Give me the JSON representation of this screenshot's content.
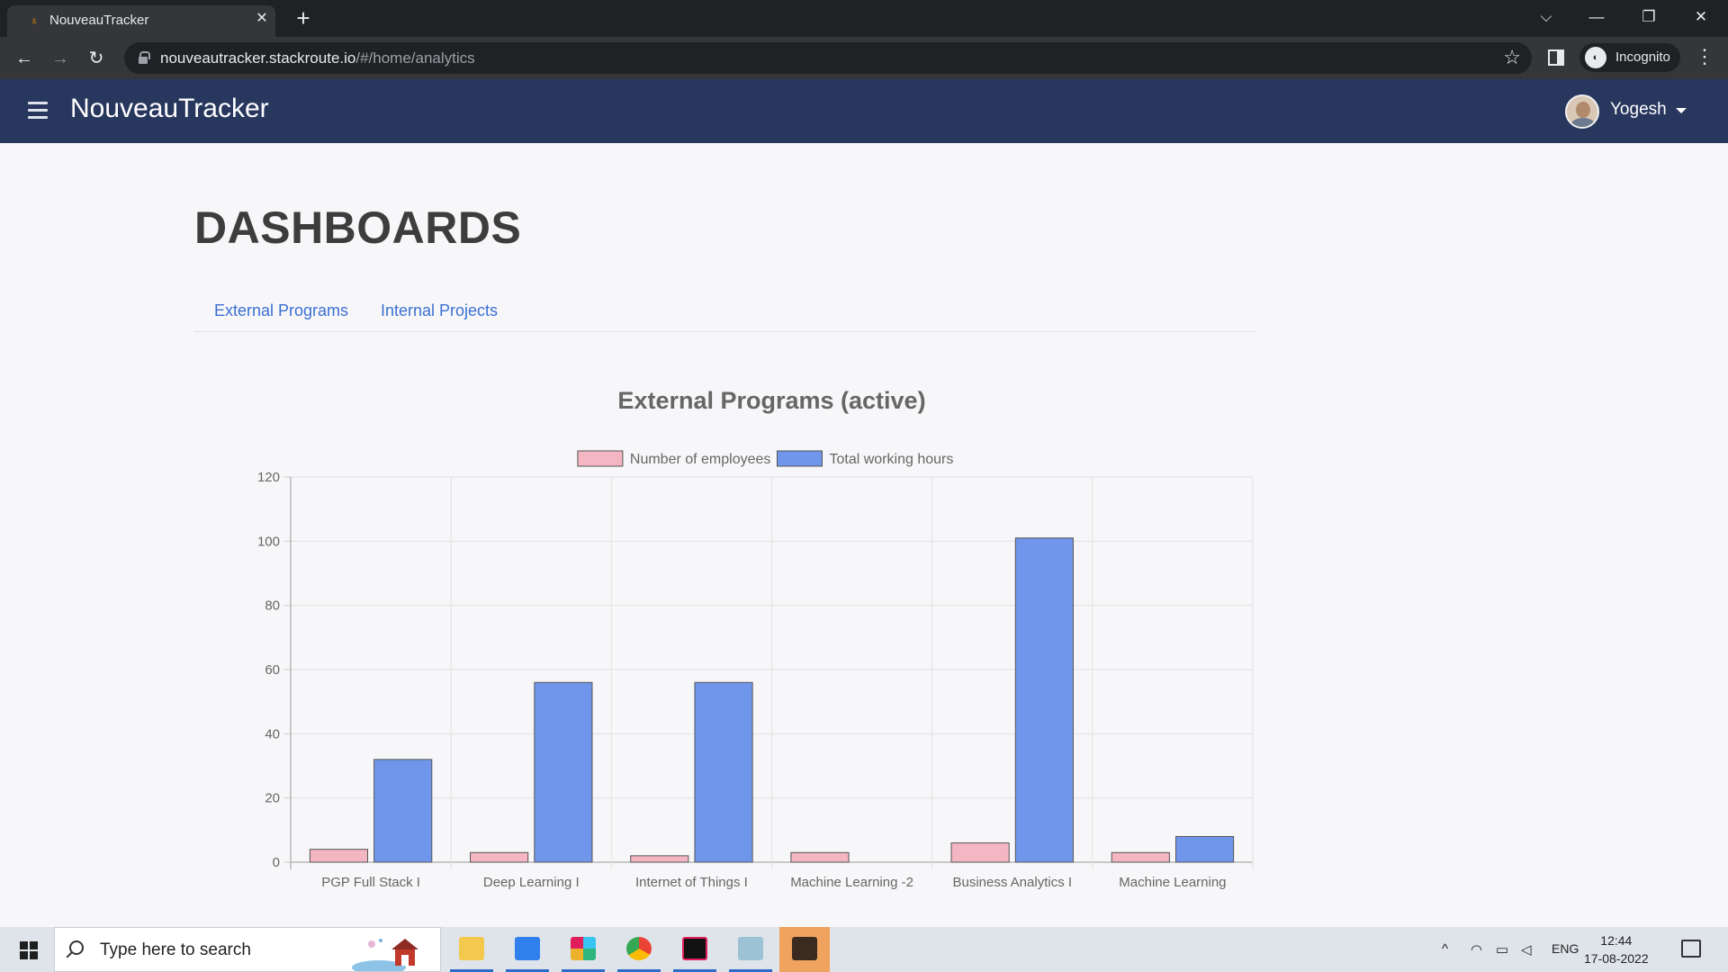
{
  "browser": {
    "tab_title": "NouveauTracker",
    "close_glyph": "✕",
    "new_tab_glyph": "+",
    "url_host": "nouveautracker.stackroute.io",
    "url_path": "/#/home/analytics",
    "profile_label": "Incognito",
    "window_controls": {
      "dropdown": "⌵",
      "minimize": "—",
      "restore": "❐",
      "close": "✕"
    },
    "nav": {
      "back": "←",
      "forward": "→",
      "reload": "↻"
    },
    "star": "☆",
    "menu": "⋮"
  },
  "app": {
    "brand": "NouveauTracker",
    "user_name": "Yogesh"
  },
  "page": {
    "title": "DASHBOARDS",
    "tabs": [
      "External Programs",
      "Internal Projects"
    ]
  },
  "chart_data": {
    "type": "bar",
    "title": "External Programs (active)",
    "categories": [
      "PGP Full Stack I",
      "Deep Learning I",
      "Internet of Things I",
      "Machine Learning -2",
      "Business Analytics I",
      "Machine Learning"
    ],
    "series": [
      {
        "name": "Number of employees",
        "values": [
          4,
          3,
          2,
          3,
          6,
          3
        ],
        "color": "#f4b6c2"
      },
      {
        "name": "Total working hours",
        "values": [
          32,
          56,
          56,
          0,
          101,
          8
        ],
        "color": "#7096ec"
      }
    ],
    "ylim": [
      0,
      120
    ],
    "yticks": [
      0,
      20,
      40,
      60,
      80,
      100,
      120
    ],
    "grid": true,
    "legend": "top"
  },
  "taskbar": {
    "search_placeholder": "Type here to search",
    "language": "ENG",
    "time": "12:44",
    "date": "17-08-2022",
    "tray_up": "^"
  }
}
